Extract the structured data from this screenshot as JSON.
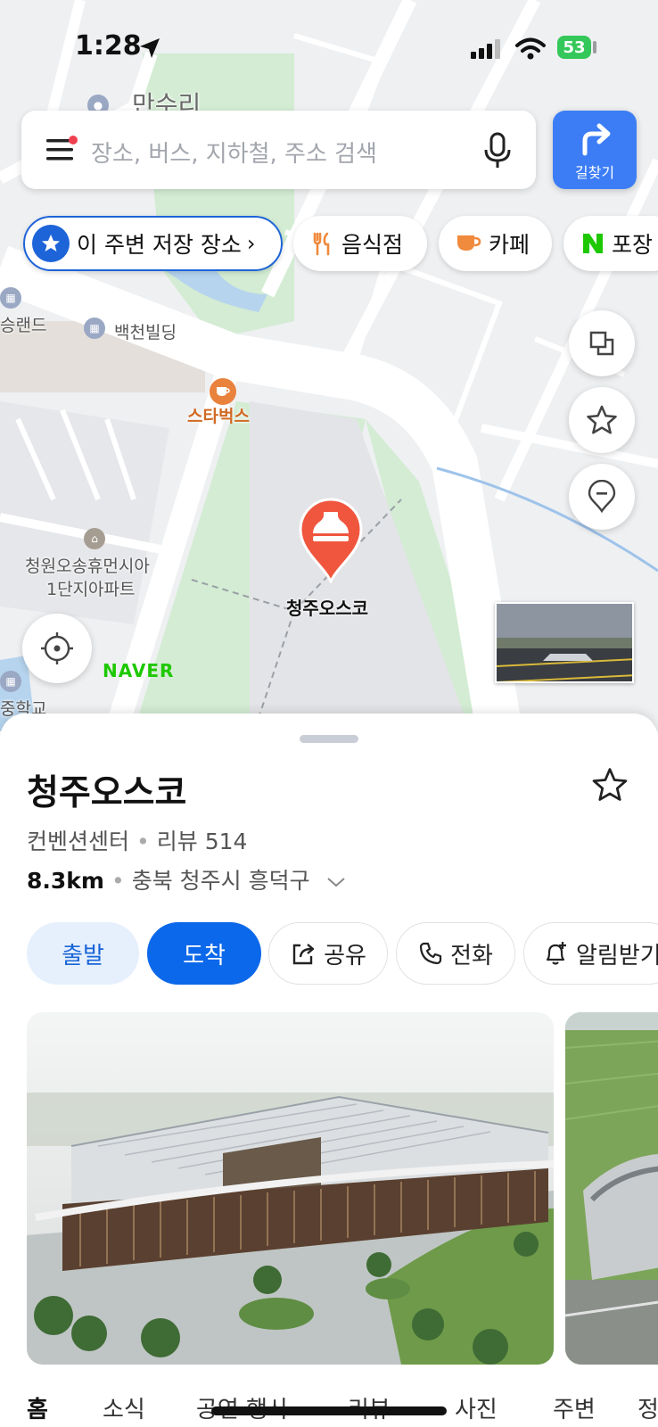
{
  "status_bar": {
    "time": "1:28",
    "battery": "53"
  },
  "search": {
    "placeholder": "장소, 버스, 지하철, 주소 검색"
  },
  "route_button": {
    "label": "길찾기"
  },
  "chips": [
    {
      "label": "이 주변 저장 장소",
      "icon": "star-icon"
    },
    {
      "label": "음식점",
      "icon": "utensils-icon"
    },
    {
      "label": "카페",
      "icon": "cup-icon"
    },
    {
      "label": "포장",
      "icon": "naver-n-icon"
    }
  ],
  "map": {
    "labels": {
      "manseuri": "만수리",
      "landeu": "승랜드",
      "baekcheon": "백천빌딩",
      "starbucks": "스타벅스",
      "apartment_line1": "청원오송휴먼시아",
      "apartment_line2": "1단지아파트",
      "school": "중학교",
      "destination": "청주오스코"
    },
    "logo": "NAVER",
    "colors": {
      "marker": "#f0563e",
      "park": "#d3ecd3",
      "water": "#b6d4ee",
      "road": "#ffffff"
    }
  },
  "place": {
    "title": "청주오스코",
    "category": "컨벤션센터",
    "review": "리뷰 514",
    "distance": "8.3km",
    "address": "충북 청주시 흥덕구"
  },
  "actions": {
    "depart": "출발",
    "arrive": "도착",
    "share": "공유",
    "call": "전화",
    "notify": "알림받기"
  },
  "tabs": [
    "홈",
    "소식",
    "공연·행사",
    "리뷰",
    "사진",
    "주변",
    "정보"
  ],
  "colors": {
    "primary": "#0c68ea",
    "depart_bg": "#e6f0fd",
    "depart_text": "#1865d8"
  }
}
